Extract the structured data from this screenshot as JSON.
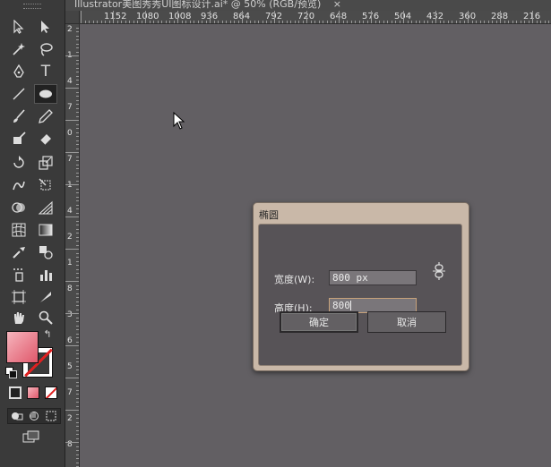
{
  "document_tab": {
    "title": "Illustrator美图秀秀UI图标设计.ai* @ 50% (RGB/预览)",
    "close_glyph": "×"
  },
  "ruler_top": {
    "labels": [
      "1152",
      "1080",
      "1008",
      "936",
      "864",
      "792",
      "720",
      "648",
      "576",
      "504",
      "432",
      "360",
      "288",
      "216"
    ]
  },
  "ruler_left": {
    "labels": [
      "2",
      "1",
      "4",
      "7",
      "0",
      "7",
      "1",
      "4",
      "2",
      "1",
      "8",
      "3",
      "6",
      "5",
      "7",
      "2",
      "8"
    ]
  },
  "toolbar": {
    "type_tool_glyph": "T",
    "swap_glyph": "↰"
  },
  "dialog": {
    "title": "椭圆",
    "width_label": "宽度(W):",
    "width_value": "800 px",
    "height_label": "高度(H):",
    "height_value": "800",
    "ok_label": "确定",
    "cancel_label": "取消"
  },
  "colors": {
    "fill_swatch": "#e0586b",
    "stroke_none": "#e02020",
    "canvas": "#625f63"
  }
}
